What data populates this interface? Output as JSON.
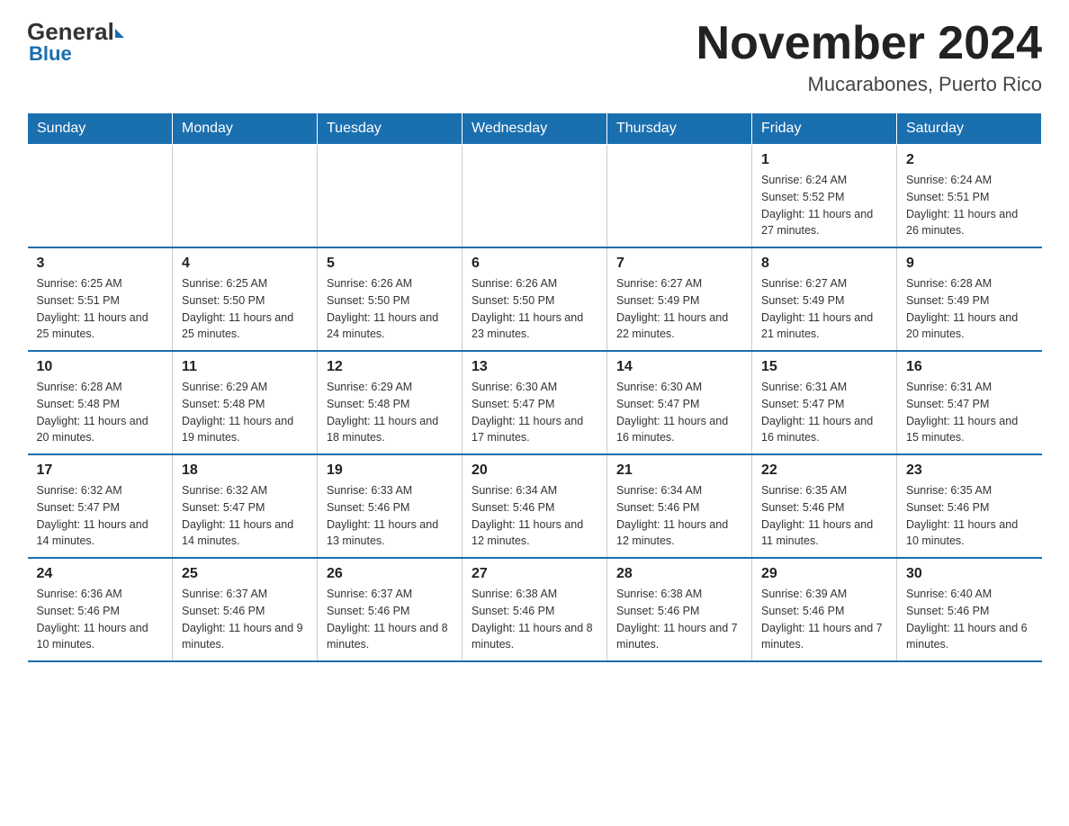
{
  "logo": {
    "general": "General",
    "blue": "Blue",
    "triangle": ""
  },
  "header": {
    "title": "November 2024",
    "subtitle": "Mucarabones, Puerto Rico"
  },
  "weekdays": [
    "Sunday",
    "Monday",
    "Tuesday",
    "Wednesday",
    "Thursday",
    "Friday",
    "Saturday"
  ],
  "rows": [
    [
      {
        "day": "",
        "info": ""
      },
      {
        "day": "",
        "info": ""
      },
      {
        "day": "",
        "info": ""
      },
      {
        "day": "",
        "info": ""
      },
      {
        "day": "",
        "info": ""
      },
      {
        "day": "1",
        "info": "Sunrise: 6:24 AM\nSunset: 5:52 PM\nDaylight: 11 hours and 27 minutes."
      },
      {
        "day": "2",
        "info": "Sunrise: 6:24 AM\nSunset: 5:51 PM\nDaylight: 11 hours and 26 minutes."
      }
    ],
    [
      {
        "day": "3",
        "info": "Sunrise: 6:25 AM\nSunset: 5:51 PM\nDaylight: 11 hours and 25 minutes."
      },
      {
        "day": "4",
        "info": "Sunrise: 6:25 AM\nSunset: 5:50 PM\nDaylight: 11 hours and 25 minutes."
      },
      {
        "day": "5",
        "info": "Sunrise: 6:26 AM\nSunset: 5:50 PM\nDaylight: 11 hours and 24 minutes."
      },
      {
        "day": "6",
        "info": "Sunrise: 6:26 AM\nSunset: 5:50 PM\nDaylight: 11 hours and 23 minutes."
      },
      {
        "day": "7",
        "info": "Sunrise: 6:27 AM\nSunset: 5:49 PM\nDaylight: 11 hours and 22 minutes."
      },
      {
        "day": "8",
        "info": "Sunrise: 6:27 AM\nSunset: 5:49 PM\nDaylight: 11 hours and 21 minutes."
      },
      {
        "day": "9",
        "info": "Sunrise: 6:28 AM\nSunset: 5:49 PM\nDaylight: 11 hours and 20 minutes."
      }
    ],
    [
      {
        "day": "10",
        "info": "Sunrise: 6:28 AM\nSunset: 5:48 PM\nDaylight: 11 hours and 20 minutes."
      },
      {
        "day": "11",
        "info": "Sunrise: 6:29 AM\nSunset: 5:48 PM\nDaylight: 11 hours and 19 minutes."
      },
      {
        "day": "12",
        "info": "Sunrise: 6:29 AM\nSunset: 5:48 PM\nDaylight: 11 hours and 18 minutes."
      },
      {
        "day": "13",
        "info": "Sunrise: 6:30 AM\nSunset: 5:47 PM\nDaylight: 11 hours and 17 minutes."
      },
      {
        "day": "14",
        "info": "Sunrise: 6:30 AM\nSunset: 5:47 PM\nDaylight: 11 hours and 16 minutes."
      },
      {
        "day": "15",
        "info": "Sunrise: 6:31 AM\nSunset: 5:47 PM\nDaylight: 11 hours and 16 minutes."
      },
      {
        "day": "16",
        "info": "Sunrise: 6:31 AM\nSunset: 5:47 PM\nDaylight: 11 hours and 15 minutes."
      }
    ],
    [
      {
        "day": "17",
        "info": "Sunrise: 6:32 AM\nSunset: 5:47 PM\nDaylight: 11 hours and 14 minutes."
      },
      {
        "day": "18",
        "info": "Sunrise: 6:32 AM\nSunset: 5:47 PM\nDaylight: 11 hours and 14 minutes."
      },
      {
        "day": "19",
        "info": "Sunrise: 6:33 AM\nSunset: 5:46 PM\nDaylight: 11 hours and 13 minutes."
      },
      {
        "day": "20",
        "info": "Sunrise: 6:34 AM\nSunset: 5:46 PM\nDaylight: 11 hours and 12 minutes."
      },
      {
        "day": "21",
        "info": "Sunrise: 6:34 AM\nSunset: 5:46 PM\nDaylight: 11 hours and 12 minutes."
      },
      {
        "day": "22",
        "info": "Sunrise: 6:35 AM\nSunset: 5:46 PM\nDaylight: 11 hours and 11 minutes."
      },
      {
        "day": "23",
        "info": "Sunrise: 6:35 AM\nSunset: 5:46 PM\nDaylight: 11 hours and 10 minutes."
      }
    ],
    [
      {
        "day": "24",
        "info": "Sunrise: 6:36 AM\nSunset: 5:46 PM\nDaylight: 11 hours and 10 minutes."
      },
      {
        "day": "25",
        "info": "Sunrise: 6:37 AM\nSunset: 5:46 PM\nDaylight: 11 hours and 9 minutes."
      },
      {
        "day": "26",
        "info": "Sunrise: 6:37 AM\nSunset: 5:46 PM\nDaylight: 11 hours and 8 minutes."
      },
      {
        "day": "27",
        "info": "Sunrise: 6:38 AM\nSunset: 5:46 PM\nDaylight: 11 hours and 8 minutes."
      },
      {
        "day": "28",
        "info": "Sunrise: 6:38 AM\nSunset: 5:46 PM\nDaylight: 11 hours and 7 minutes."
      },
      {
        "day": "29",
        "info": "Sunrise: 6:39 AM\nSunset: 5:46 PM\nDaylight: 11 hours and 7 minutes."
      },
      {
        "day": "30",
        "info": "Sunrise: 6:40 AM\nSunset: 5:46 PM\nDaylight: 11 hours and 6 minutes."
      }
    ]
  ]
}
